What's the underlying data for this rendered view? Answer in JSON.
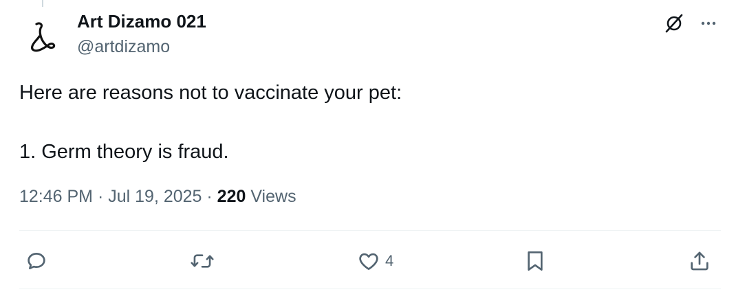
{
  "author": {
    "display_name": "Art Dizamo 021",
    "handle": "@artdizamo"
  },
  "post": {
    "line1": "Here are reasons not to vaccinate your pet:",
    "line2": "1. Germ theory is fraud."
  },
  "meta": {
    "time": "12:46 PM",
    "separator1": " · ",
    "date": "Jul 19, 2025",
    "separator2": " · ",
    "views_count": "220",
    "views_label": " Views"
  },
  "actions": {
    "likes_count": "4"
  },
  "icons": {
    "grok": "grok-icon",
    "more": "more-icon",
    "reply": "reply-icon",
    "repost": "repost-icon",
    "like": "heart-icon",
    "bookmark": "bookmark-icon",
    "share": "share-icon"
  },
  "colors": {
    "text_primary": "#0f1419",
    "text_secondary": "#536471",
    "divider": "#eff3f4"
  }
}
